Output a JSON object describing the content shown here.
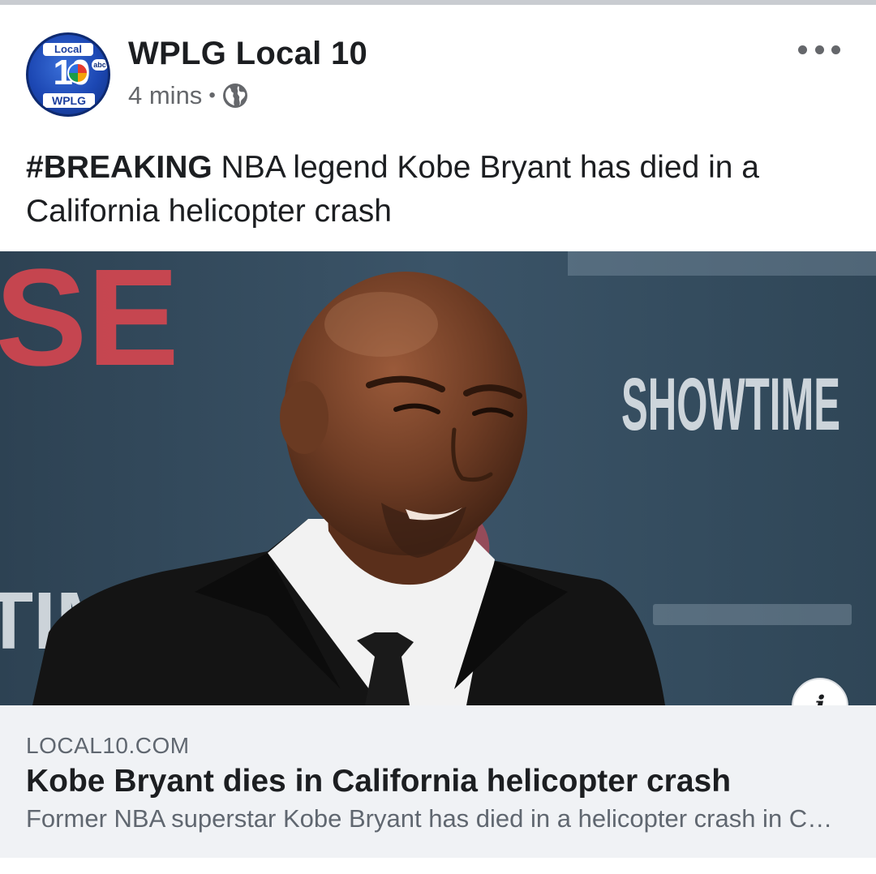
{
  "post": {
    "page_name": "WPLG Local 10",
    "timestamp": "4 mins",
    "separator": "•",
    "privacy_icon": "globe-icon",
    "more_icon": "more-horizontal-icon",
    "avatar": {
      "top_text": "Local",
      "number": "10",
      "network": "abc",
      "bottom_text": "WPLG"
    },
    "text": {
      "hashtag": "#BREAKING",
      "body": " NBA legend Kobe Bryant has died in a California helicopter crash"
    }
  },
  "photo": {
    "backdrop_text_left_top": "SE",
    "backdrop_text_right": "SHOWTIME",
    "backdrop_text_left_bottom": "TIME",
    "info_icon": "info-icon",
    "info_label": "i"
  },
  "link_preview": {
    "domain": "LOCAL10.COM",
    "title": "Kobe Bryant dies in California helicopter crash",
    "description": "Former NBA superstar Kobe Bryant has died in a helicopter crash in Calabasas, California"
  },
  "colors": {
    "text_primary": "#1c1e21",
    "text_secondary": "#65676b",
    "card_background": "#f0f2f5",
    "backdrop_blue": "#3a5367",
    "backdrop_red": "#e0464f"
  }
}
